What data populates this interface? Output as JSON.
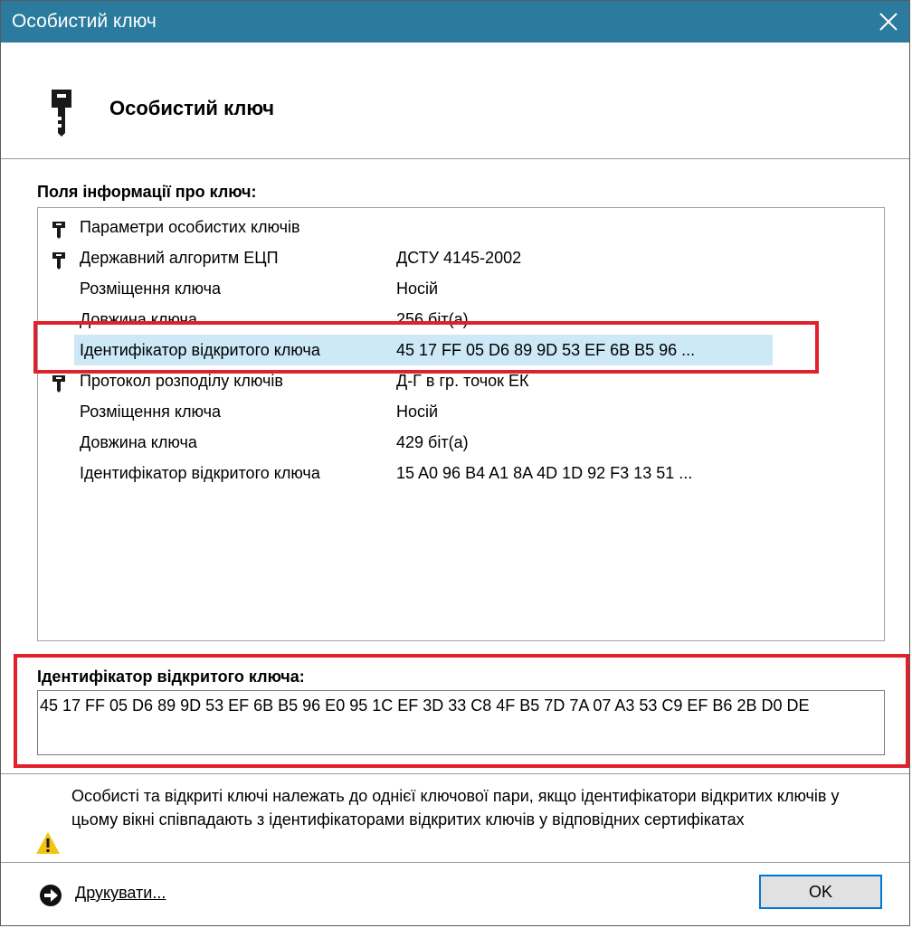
{
  "window": {
    "title": "Особистий ключ",
    "titlebar_color": "#2b7b9e"
  },
  "header": {
    "heading": "Особистий ключ",
    "icon": "key-icon"
  },
  "fields": {
    "label": "Поля інформації про ключ:",
    "rows": [
      {
        "name": "Параметри особистих ключів",
        "value": "",
        "icon": "key-icon"
      },
      {
        "name": "Державний алгоритм ЕЦП",
        "value": "ДСТУ 4145-2002",
        "icon": "key-icon"
      },
      {
        "name": "Розміщення ключа",
        "value": "Носій",
        "icon": ""
      },
      {
        "name": "Довжина ключа",
        "value": "256 біт(а)",
        "icon": ""
      },
      {
        "name": "Ідентифікатор відкритого ключа",
        "value": "45 17 FF 05 D6 89 9D 53 EF 6B B5 96 ...",
        "icon": "",
        "selected": true
      },
      {
        "name": "Протокол розподілу ключів",
        "value": "Д-Г в гр. точок ЕК",
        "icon": "key-icon"
      },
      {
        "name": "Розміщення ключа",
        "value": "Носій",
        "icon": ""
      },
      {
        "name": "Довжина ключа",
        "value": "429 біт(а)",
        "icon": ""
      },
      {
        "name": "Ідентифікатор відкритого ключа",
        "value": "15 A0 96 B4 A1 8A 4D 1D 92 F3 13 51 ...",
        "icon": ""
      }
    ]
  },
  "detail": {
    "label": "Ідентифікатор відкритого ключа:",
    "value": "45 17 FF 05 D6 89 9D 53 EF 6B B5 96 E0 95 1C EF 3D 33 C8 4F B5 7D 7A 07 A3 53 C9 EF B6 2B D0 DE"
  },
  "warning": {
    "text": "Особисті та відкриті ключі належать до однієї ключової пари, якщо ідентифікатори відкритих ключів у цьому вікні співпадають з ідентифікаторами відкритих ключів у відповідних сертифікатах",
    "icon": "warning-icon"
  },
  "footer": {
    "print_label": "Друкувати...",
    "ok_label": "OK"
  },
  "highlight_color": "#e0202a"
}
